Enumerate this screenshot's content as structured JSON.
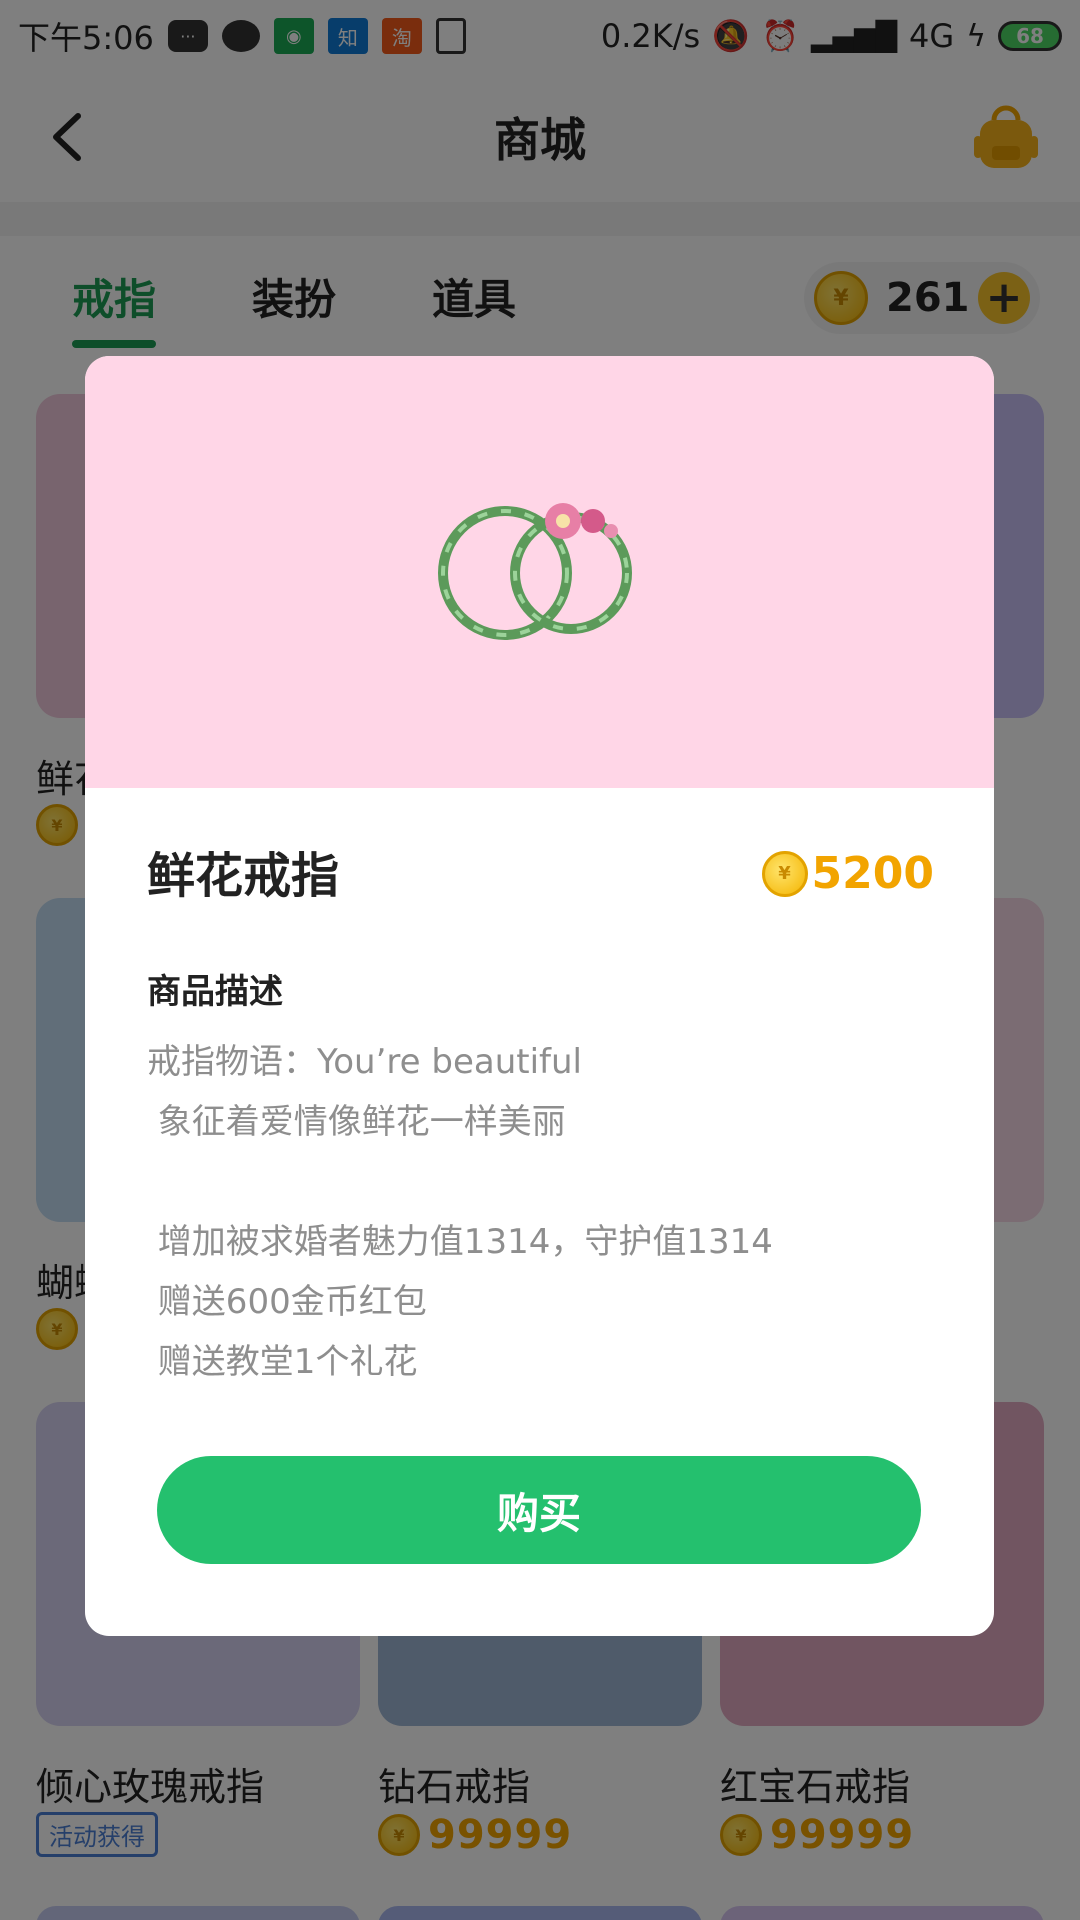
{
  "status_bar": {
    "time": "下午5:06",
    "net_speed": "0.2K/s",
    "network_type": "4G",
    "battery": "68",
    "icons": [
      "message-icon",
      "wechat-icon",
      "security-app-icon",
      "zhihu-icon",
      "taobao-icon",
      "document-icon",
      "mute-bell-icon",
      "alarm-icon",
      "signal-icon",
      "charging-icon"
    ]
  },
  "header": {
    "title": "商城",
    "back_icon": "chevron-left-icon",
    "bag_icon": "backpack-icon"
  },
  "tabs": {
    "items": [
      {
        "label": "戒指",
        "active": true
      },
      {
        "label": "装扮",
        "active": false
      },
      {
        "label": "道具",
        "active": false
      }
    ],
    "coin_balance": "261",
    "add_label": "+",
    "coin_symbol": "¥"
  },
  "grid": {
    "rows": [
      [
        {
          "name": "鲜花戒指",
          "price": "",
          "color": "#f0c8dc"
        },
        {
          "name": "",
          "price": "",
          "color": "#cfe0f2"
        },
        {
          "name": "",
          "price": "",
          "color": "#c8c0f6"
        }
      ],
      [
        {
          "name": "蝴蝶戒指",
          "price": "",
          "color": "#c2ddf2"
        },
        {
          "name": "",
          "price": "",
          "color": "#dfe9f4"
        },
        {
          "name": "",
          "price": "",
          "color": "#f6d8e6"
        }
      ],
      [
        {
          "name": "倾心玫瑰戒指",
          "badge": "活动获得",
          "color": "#d7d2f2"
        },
        {
          "name": "钻石戒指",
          "price": "99999",
          "color": "#9fb6d4"
        },
        {
          "name": "红宝石戒指",
          "price": "99999",
          "color": "#e3aac2"
        }
      ]
    ]
  },
  "modal": {
    "product_name": "鲜花戒指",
    "price": "5200",
    "hero_color": "#ffd6e7",
    "desc_heading": "商品描述",
    "desc_lines": [
      "戒指物语：You’re beautiful",
      " 象征着爱情像鲜花一样美丽",
      "",
      " 增加被求婚者魅力值1314，守护值1314",
      " 赠送600金币红包",
      " 赠送教堂1个礼花"
    ],
    "buy_label": "购买"
  },
  "colors": {
    "accent_green": "#24c06e",
    "tab_active": "#1c9c55",
    "coin_gold": "#f2a400",
    "overlay": "rgba(0,0,0,0.5)"
  }
}
